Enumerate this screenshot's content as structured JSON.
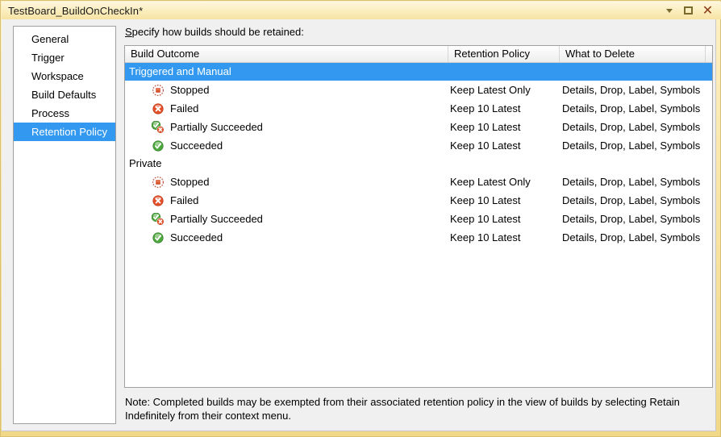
{
  "window": {
    "title": "TestBoard_BuildOnCheckIn*",
    "controls": {
      "dropdown_label": "",
      "maximize_label": "",
      "close_label": "✕"
    }
  },
  "sidebar": {
    "items": [
      {
        "label": "General",
        "selected": false
      },
      {
        "label": "Trigger",
        "selected": false
      },
      {
        "label": "Workspace",
        "selected": false
      },
      {
        "label": "Build Defaults",
        "selected": false
      },
      {
        "label": "Process",
        "selected": false
      },
      {
        "label": "Retention Policy",
        "selected": true
      }
    ]
  },
  "pane": {
    "instruction_accesskey": "S",
    "instruction_rest": "pecify how builds should be retained:",
    "note": "Note: Completed builds may be exempted from their associated retention policy in the view of builds by selecting Retain Indefinitely from their context menu."
  },
  "grid": {
    "headers": {
      "outcome": "Build Outcome",
      "policy": "Retention Policy",
      "delete": "What to Delete"
    },
    "groups": [
      {
        "name": "Triggered and Manual",
        "highlighted": true,
        "rows": [
          {
            "icon": "stopped-icon",
            "outcome": "Stopped",
            "policy": "Keep Latest Only",
            "delete": "Details, Drop, Label, Symbols"
          },
          {
            "icon": "failed-icon",
            "outcome": "Failed",
            "policy": "Keep 10 Latest",
            "delete": "Details, Drop, Label, Symbols"
          },
          {
            "icon": "partially-succeeded-icon",
            "outcome": "Partially Succeeded",
            "policy": "Keep 10 Latest",
            "delete": "Details, Drop, Label, Symbols"
          },
          {
            "icon": "succeeded-icon",
            "outcome": "Succeeded",
            "policy": "Keep 10 Latest",
            "delete": "Details, Drop, Label, Symbols"
          }
        ]
      },
      {
        "name": "Private",
        "highlighted": false,
        "rows": [
          {
            "icon": "stopped-icon",
            "outcome": "Stopped",
            "policy": "Keep Latest Only",
            "delete": "Details, Drop, Label, Symbols"
          },
          {
            "icon": "failed-icon",
            "outcome": "Failed",
            "policy": "Keep 10 Latest",
            "delete": "Details, Drop, Label, Symbols"
          },
          {
            "icon": "partially-succeeded-icon",
            "outcome": "Partially Succeeded",
            "policy": "Keep 10 Latest",
            "delete": "Details, Drop, Label, Symbols"
          },
          {
            "icon": "succeeded-icon",
            "outcome": "Succeeded",
            "policy": "Keep 10 Latest",
            "delete": "Details, Drop, Label, Symbols"
          }
        ]
      }
    ]
  },
  "colors": {
    "selection_blue": "#3399f0",
    "title_gradient_top": "#fdf6dd",
    "title_gradient_bottom": "#f6e3a2",
    "frame_tan": "#f1d888",
    "client_gray": "#f0f0f0",
    "success_green": "#3f9a34",
    "error_red": "#d83b1e",
    "stopped_red": "#d1503c"
  }
}
